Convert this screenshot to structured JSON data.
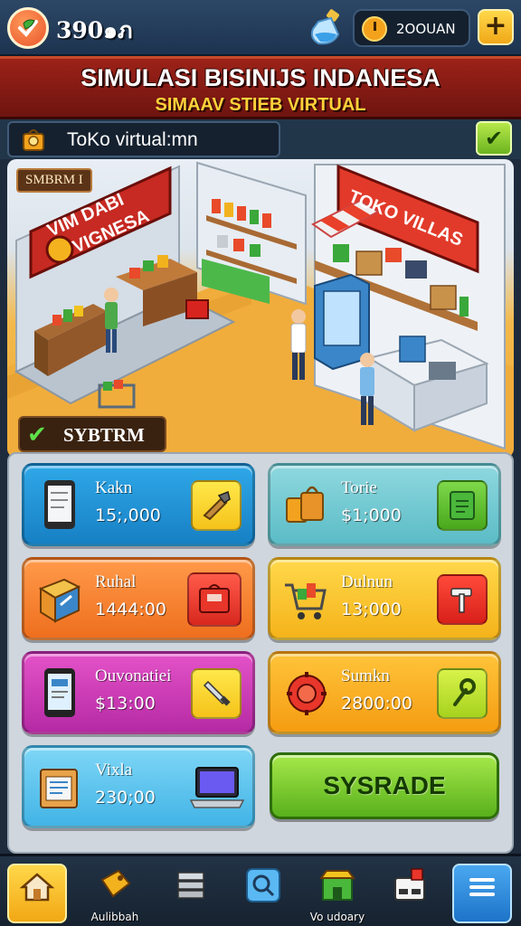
{
  "header": {
    "coins": "390๑ภ",
    "timer": "2OOUAN",
    "plus_label": "+"
  },
  "title": {
    "main": "SIMULASI BISINIJS INDANESA",
    "sub": "SIMAAV STIEB VIRTUAL"
  },
  "store": {
    "name": "ToKo virtual:mn",
    "confirm_icon": "check-icon"
  },
  "scene": {
    "tag": "SMBRM I",
    "sign_left_line1": "VIM DABI",
    "sign_left_line2": "VIGNESA",
    "sign_right": "TOKO VILLAS",
    "section_label": "SYBTRM"
  },
  "cards": [
    {
      "name": "Kakn",
      "price": "15;,000",
      "color": "blue",
      "item_icon": "phone-icon",
      "action_icon": "tool-icon"
    },
    {
      "name": "Torie",
      "price": "$1;000",
      "color": "teal",
      "item_icon": "bag-icon",
      "action_icon": "notebook-icon"
    },
    {
      "name": "Ruhal",
      "price": "1444:00",
      "color": "orange",
      "item_icon": "box-icon",
      "action_icon": "storage-icon"
    },
    {
      "name": "Dulnun",
      "price": "13;000",
      "color": "yellow",
      "item_icon": "cart-icon",
      "action_icon": "hammer-icon"
    },
    {
      "name": "Ouvonatiei",
      "price": "$13:00",
      "color": "magenta",
      "item_icon": "tablet-icon",
      "action_icon": "knife-icon"
    },
    {
      "name": "Sumkn",
      "price": "2800:00",
      "color": "amber",
      "item_icon": "gear-icon",
      "action_icon": "wrench-icon"
    },
    {
      "name": "Vixla",
      "price": "230;00",
      "color": "sky",
      "item_icon": "package-icon",
      "action_icon": "laptop-icon"
    }
  ],
  "upgrade_label": "SYSRADE",
  "nav": [
    {
      "icon": "home-icon",
      "label": ""
    },
    {
      "icon": "tag-icon",
      "label": "Aulibbah"
    },
    {
      "icon": "stack-icon",
      "label": ""
    },
    {
      "icon": "search-icon",
      "label": ""
    },
    {
      "icon": "store-icon",
      "label": "Vo udoary"
    },
    {
      "icon": "register-icon",
      "label": ""
    },
    {
      "icon": "menu-icon",
      "label": ""
    }
  ],
  "colors": {
    "header": "#1d3450",
    "banner": "#9c2218",
    "accent_yellow": "#ffd23a",
    "upgrade_green": "#58b01c"
  }
}
